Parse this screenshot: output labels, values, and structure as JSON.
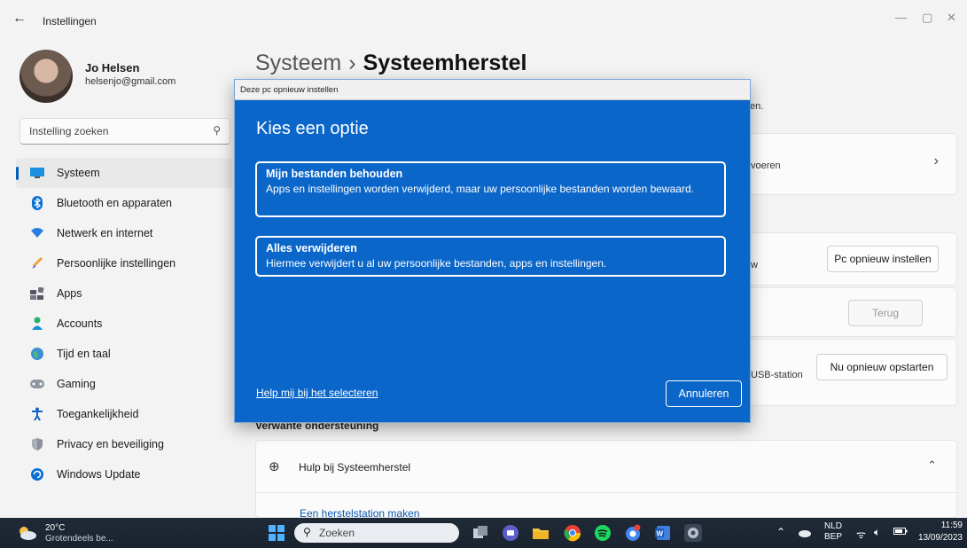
{
  "window": {
    "title": "Instellingen",
    "back_glyph": "←",
    "controls": [
      "—",
      "▢",
      "✕"
    ]
  },
  "profile": {
    "name": "Jo Helsen",
    "email": "helsenjo@gmail.com"
  },
  "search": {
    "placeholder": "Instelling zoeken"
  },
  "sidebar": {
    "items": [
      {
        "label": "Systeem",
        "icon": "monitor-icon",
        "active": true
      },
      {
        "label": "Bluetooth en apparaten",
        "icon": "bluetooth-icon"
      },
      {
        "label": "Netwerk en internet",
        "icon": "wifi-icon"
      },
      {
        "label": "Persoonlijke instellingen",
        "icon": "brush-icon"
      },
      {
        "label": "Apps",
        "icon": "apps-icon"
      },
      {
        "label": "Accounts",
        "icon": "person-icon"
      },
      {
        "label": "Tijd en taal",
        "icon": "globe-clock-icon"
      },
      {
        "label": "Gaming",
        "icon": "gamepad-icon"
      },
      {
        "label": "Toegankelijkheid",
        "icon": "accessibility-icon"
      },
      {
        "label": "Privacy en beveiliging",
        "icon": "shield-icon"
      },
      {
        "label": "Windows Update",
        "icon": "update-icon"
      }
    ]
  },
  "breadcrumb": {
    "parent": "Systeem",
    "separator": "›",
    "current": "Systeemherstel"
  },
  "main": {
    "frag_subtitle": "en.",
    "frag_row1": "voeren",
    "frag_row2": "w",
    "frag_row3": "USB-station",
    "reset_pc_button": "Pc opnieuw instellen",
    "back_button": "Terug",
    "restart_now_button": "Nu opnieuw opstarten",
    "related_support_header": "Verwante ondersteuning",
    "help_row_label": "Hulp bij Systeemherstel",
    "recovery_drive_link": "Een herstelstation maken"
  },
  "dialog": {
    "title": "Deze pc opnieuw instellen",
    "heading": "Kies een optie",
    "options": [
      {
        "title": "Mijn bestanden behouden",
        "description": "Apps en instellingen worden verwijderd, maar uw persoonlijke bestanden worden bewaard."
      },
      {
        "title": "Alles verwijderen",
        "description": "Hiermee verwijdert u al uw persoonlijke bestanden, apps en instellingen."
      }
    ],
    "help_link": "Help mij bij het selecteren",
    "cancel_button": "Annuleren"
  },
  "taskbar": {
    "weather_temp": "20°C",
    "weather_desc": "Grotendeels be...",
    "search_placeholder": "Zoeken",
    "language_top": "NLD",
    "language_bottom": "BEP",
    "time": "11:59",
    "date": "13/09/2023"
  },
  "colors": {
    "accent": "#005fb8",
    "dialog_bg": "#0b66c9",
    "taskbar_bg": "#1f2937"
  }
}
